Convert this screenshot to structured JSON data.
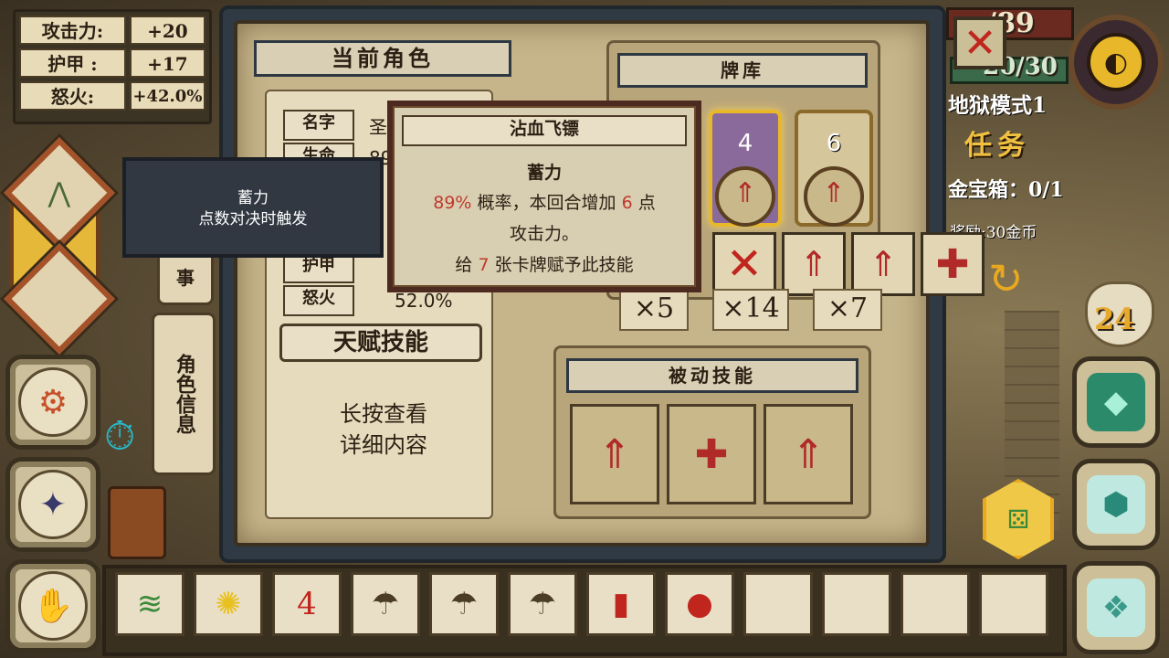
{
  "stats": [
    {
      "label": "攻击力:",
      "value": "+20"
    },
    {
      "label": "护甲 :",
      "value": "+17"
    },
    {
      "label": "怒火:",
      "value": "+42.0%"
    }
  ],
  "panel": {
    "title": "当前角色",
    "deck_title": "牌库",
    "passive_title": "被动技能",
    "info_rows": [
      {
        "label": "名字",
        "value": "圣"
      },
      {
        "label": "生命",
        "value": "89"
      },
      {
        "label": "护甲",
        "value": ""
      },
      {
        "label": "怒火",
        "value": "52.0%"
      }
    ],
    "talent_title": "天赋技能",
    "talent_hint_line1": "长按查看",
    "talent_hint_line2": "详细内容",
    "side_tab_info": "角色信息",
    "side_tab_story": "事"
  },
  "tooltip_dark": {
    "title": "蓄力",
    "desc": "点数对决时触发"
  },
  "tooltip_card": {
    "title": "沾血飞镖",
    "skill": "蓄力",
    "chance": "89%",
    "line1_a": "概率，本回合增加",
    "amount": "6",
    "line1_b": "点",
    "line2": "攻击力。",
    "line3_a": "给",
    "cards": "7",
    "line3_b": "张卡牌赋予此技能"
  },
  "deck": {
    "cards": [
      {
        "number": "4",
        "icon": "dart-icon"
      },
      {
        "number": "6",
        "icon": "dart-icon"
      }
    ],
    "counts": [
      "×5",
      "×14",
      "×7"
    ],
    "action_icons": [
      "cross-icon",
      "dart-badge-icon",
      "dart-icon",
      "heal-icon"
    ]
  },
  "passives": [
    "dart-badge-icon",
    "heal-hand-icon",
    "dart-badge-icon"
  ],
  "hud": {
    "hp": "89/89",
    "hp_shown": "/89",
    "armor": "20/30",
    "mode": "地狱模式1",
    "quest_title": "任务",
    "quest_item": "金宝箱：0/1",
    "reward": "奖励:30金币",
    "gold": "24"
  },
  "inventory": [
    {
      "icon": "herb-icon"
    },
    {
      "icon": "sun-flower-icon"
    },
    {
      "icon": "scroll-4-icon",
      "text": "4"
    },
    {
      "icon": "mushroom-icon"
    },
    {
      "icon": "mushroom-icon"
    },
    {
      "icon": "mushroom-icon"
    },
    {
      "icon": "vial-icon"
    },
    {
      "icon": "potion-icon"
    },
    {
      "icon": ""
    },
    {
      "icon": ""
    },
    {
      "icon": ""
    },
    {
      "icon": ""
    }
  ],
  "colors": {
    "accent_red": "#c0392b",
    "gold": "#e8b82a",
    "panel_slate": "#2f3a44"
  }
}
